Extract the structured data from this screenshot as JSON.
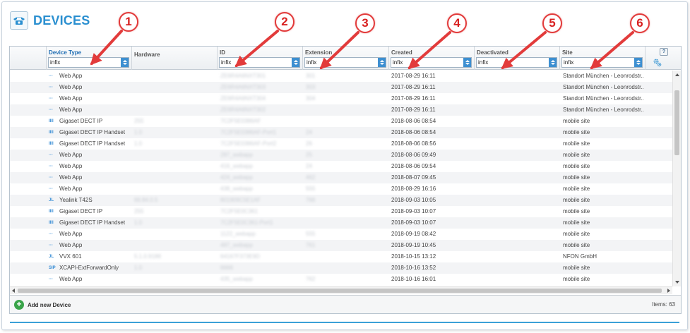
{
  "page": {
    "title": "DEVICES",
    "title_icon": "telephone-icon"
  },
  "columns": [
    {
      "key": "type",
      "label": "Device Type",
      "filter": "infix",
      "active": true
    },
    {
      "key": "hw",
      "label": "Hardware"
    },
    {
      "key": "id",
      "label": "ID",
      "filter": "infix"
    },
    {
      "key": "ext",
      "label": "Extension",
      "filter": "infix"
    },
    {
      "key": "created",
      "label": "Created",
      "filter": "infix"
    },
    {
      "key": "deact",
      "label": "Deactivated",
      "filter": "infix"
    },
    {
      "key": "site",
      "label": "Site",
      "filter": "infix"
    }
  ],
  "toolbar": {
    "help_label": "?",
    "settings_icon": "gears-icon"
  },
  "rows": [
    {
      "icon": "···",
      "type": "Web App",
      "hw": "",
      "id": "ZE6R4A6NXT301",
      "ext": "301",
      "created": "2017-08-29 16:11",
      "site": "Standort München - Leonrodstr..."
    },
    {
      "icon": "···",
      "type": "Web App",
      "hw": "",
      "id": "ZE6R4A6NXT303",
      "ext": "303",
      "created": "2017-08-29 16:11",
      "site": "Standort München - Leonrodstr..."
    },
    {
      "icon": "···",
      "type": "Web App",
      "hw": "",
      "id": "ZE6R4A6NXT304",
      "ext": "304",
      "created": "2017-08-29 16:11",
      "site": "Standort München - Leonrodstr..."
    },
    {
      "icon": "···",
      "type": "Web App",
      "hw": "",
      "id": "ZE6R4A6NXT302",
      "ext": "",
      "created": "2017-08-29 16:11",
      "site": "Standort München - Leonrodstr..."
    },
    {
      "icon": "IIII",
      "type": "Gigaset DECT IP",
      "hw": "255",
      "id": "7C2F5E0386AF",
      "ext": "",
      "created": "2018-08-06 08:54",
      "site": "mobile site"
    },
    {
      "icon": "IIII",
      "type": "Gigaset DECT IP Handset",
      "hw": "1.0",
      "id": "7C2F5E0386AF-Port1",
      "ext": "24",
      "created": "2018-08-06 08:54",
      "site": "mobile site"
    },
    {
      "icon": "IIII",
      "type": "Gigaset DECT IP Handset",
      "hw": "1.0",
      "id": "7C2F5E0386AF-Port2",
      "ext": "26",
      "created": "2018-08-06 08:56",
      "site": "mobile site"
    },
    {
      "icon": "···",
      "type": "Web App",
      "hw": "",
      "id": "287_webapp",
      "ext": "25",
      "created": "2018-08-06 09:49",
      "site": "mobile site"
    },
    {
      "icon": "···",
      "type": "Web App",
      "hw": "",
      "id": "416_webapp",
      "ext": "24",
      "created": "2018-08-06 09:54",
      "site": "mobile site"
    },
    {
      "icon": "···",
      "type": "Web App",
      "hw": "",
      "id": "424_webapp",
      "ext": "462",
      "created": "2018-08-07 09:45",
      "site": "mobile site"
    },
    {
      "icon": "···",
      "type": "Web App",
      "hw": "",
      "id": "438_webapp",
      "ext": "555",
      "created": "2018-08-29 16:16",
      "site": "mobile site"
    },
    {
      "icon": "JL",
      "type": "Yealink T42S",
      "hw": "66.84.0.5",
      "id": "801909C5E1AF",
      "ext": "766",
      "created": "2018-09-03 10:05",
      "site": "mobile site"
    },
    {
      "icon": "IIII",
      "type": "Gigaset DECT IP",
      "hw": "255",
      "id": "7C2F5E0C361",
      "ext": "",
      "created": "2018-09-03 10:07",
      "site": "mobile site"
    },
    {
      "icon": "IIII",
      "type": "Gigaset DECT IP Handset",
      "hw": "1.0",
      "id": "7C2F5E0C361-Port1",
      "ext": "",
      "created": "2018-09-03 10:07",
      "site": "mobile site"
    },
    {
      "icon": "···",
      "type": "Web App",
      "hw": "",
      "id": "1122_webapp",
      "ext": "555",
      "created": "2018-09-19 08:42",
      "site": "mobile site"
    },
    {
      "icon": "···",
      "type": "Web App",
      "hw": "",
      "id": "487_webapp",
      "ext": "761",
      "created": "2018-09-19 10:45",
      "site": "mobile site"
    },
    {
      "icon": "JL",
      "type": "VVX 601",
      "hw": "5.1.0.9188",
      "id": "64167F373E9D",
      "ext": "",
      "created": "2018-10-15 13:12",
      "site": "NFON GmbH"
    },
    {
      "icon": "SIP",
      "type": "XCAPI-ExtForwardOnly",
      "hw": "1.0",
      "id": "6666",
      "ext": "",
      "created": "2018-10-16 13:52",
      "site": "mobile site"
    },
    {
      "icon": "···",
      "type": "Web App",
      "hw": "",
      "id": "435_webapp",
      "ext": "762",
      "created": "2018-10-16 16:01",
      "site": "mobile site"
    }
  ],
  "footer": {
    "add_label": "Add new Device",
    "items_count": "Items: 63"
  },
  "markers": [
    "1",
    "2",
    "3",
    "4",
    "5",
    "6"
  ],
  "colors": {
    "accent": "#2a8fd0",
    "marker": "#e23b3b",
    "add": "#3aa44a"
  }
}
